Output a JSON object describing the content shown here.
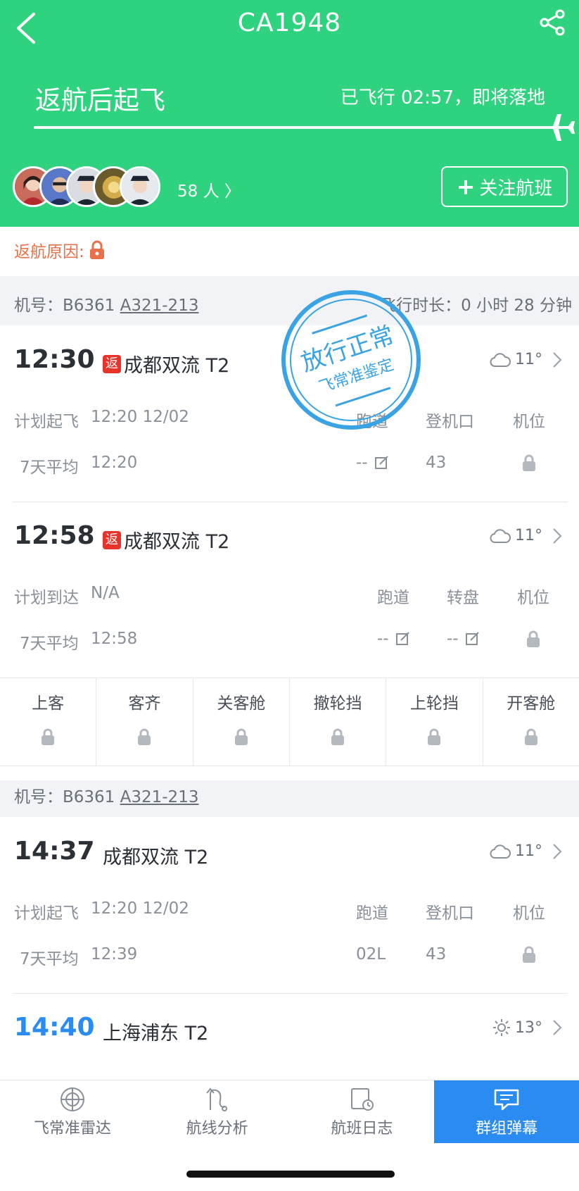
{
  "header": {
    "flight_no": "CA1948",
    "status": "返航后起飞",
    "elapsed": "已飞行 02:57，即将落地",
    "people": "58 人",
    "follow_label": "关注航班",
    "progress": 1.0,
    "bg_color": "#2fd37f"
  },
  "return_reason_label": "返航原因:",
  "plane_bar_1": {
    "reg_label": "机号：",
    "reg": "B6361",
    "model": "A321-213",
    "duration": "飞行时长：0 小时 28 分钟"
  },
  "seg1": {
    "time": "12:30",
    "badge": "返",
    "airport": "成都双流 T2",
    "temp": "11°",
    "plan_label": "计划起飞",
    "plan_value": "12:20 12/02",
    "avg_label": "7天平均",
    "avg_value": "12:20",
    "col1": "跑道",
    "col2": "登机口",
    "col3": "机位",
    "val1": "--",
    "val2": "43"
  },
  "seg2": {
    "time": "12:58",
    "badge": "返",
    "airport": "成都双流 T2",
    "temp": "11°",
    "plan_label": "计划到达",
    "plan_value": "N/A",
    "avg_label": "7天平均",
    "avg_value": "12:58",
    "col1": "跑道",
    "col2": "转盘",
    "col3": "机位",
    "val1": "--",
    "val2": "--"
  },
  "steps": [
    "上客",
    "客齐",
    "关客舱",
    "撤轮挡",
    "上轮挡",
    "开客舱"
  ],
  "plane_bar_2": {
    "reg_label": "机号：",
    "reg": "B6361",
    "model": "A321-213"
  },
  "seg3": {
    "time": "14:37",
    "airport": "成都双流 T2",
    "temp": "11°",
    "plan_label": "计划起飞",
    "plan_value": "12:20 12/02",
    "avg_label": "7天平均",
    "avg_value": "12:39",
    "col1": "跑道",
    "col2": "登机口",
    "col3": "机位",
    "val1": "02L",
    "val2": "43"
  },
  "seg4": {
    "time": "14:40",
    "airport": "上海浦东 T2",
    "temp": "13°"
  },
  "stamp": {
    "top": "放行正常",
    "bottom": "飞常准鉴定",
    "color": "#3aa3e3"
  },
  "tabs": [
    {
      "label": "飞常准雷达",
      "icon": "radar-icon"
    },
    {
      "label": "航线分析",
      "icon": "route-icon"
    },
    {
      "label": "航班日志",
      "icon": "log-icon"
    },
    {
      "label": "群组弹幕",
      "icon": "chat-icon",
      "active": true
    }
  ]
}
